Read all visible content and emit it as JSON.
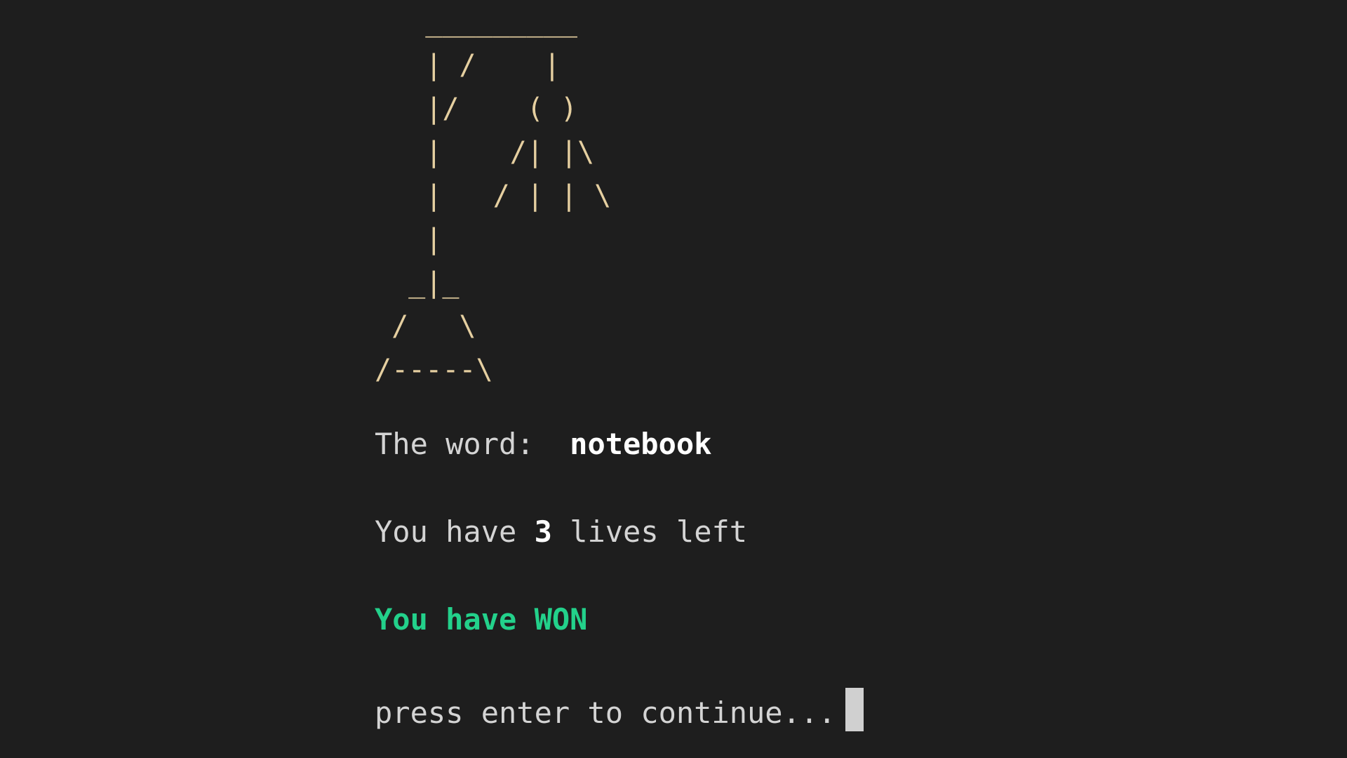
{
  "hangman_art": [
    "   _________",
    "   | /    |",
    "   |/    ( )",
    "   |    /| |\\",
    "   |   / | | \\",
    "   |",
    "  _|_",
    " /   \\",
    "/-----\\"
  ],
  "word": {
    "label": "The word:",
    "value": "notebook"
  },
  "lives": {
    "prefix": "You have",
    "count": "3",
    "suffix": "lives left"
  },
  "result": {
    "message": "You have WON"
  },
  "prompt": {
    "text": "press enter to continue..."
  },
  "colors": {
    "background": "#1e1e1e",
    "art": "#e5cfa0",
    "success": "#23d18b",
    "text": "#d4d4d4"
  }
}
